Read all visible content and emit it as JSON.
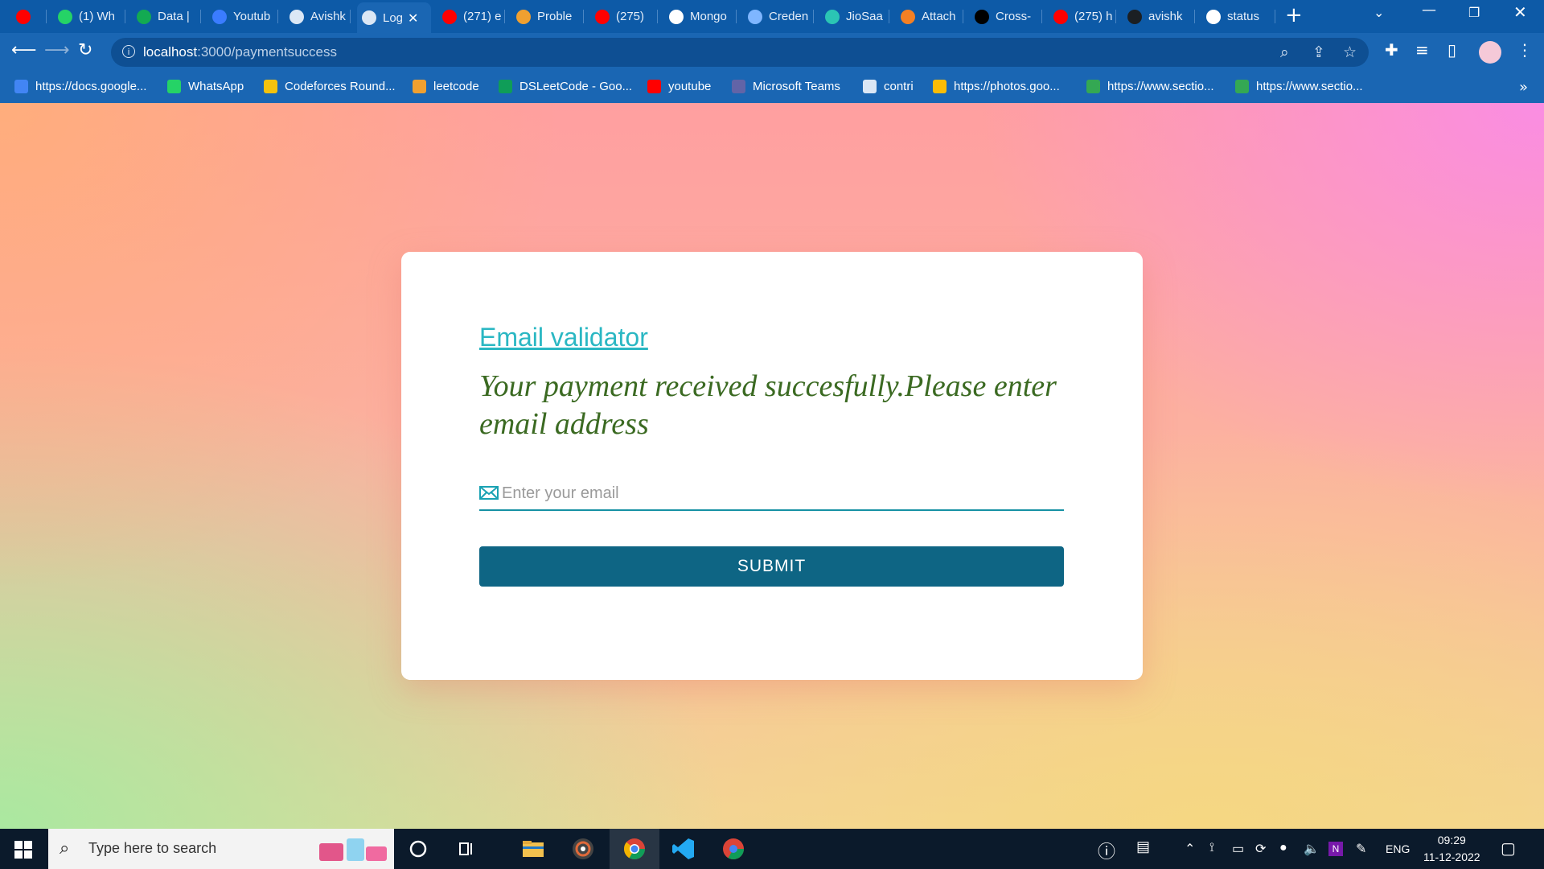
{
  "tabs": [
    {
      "title": "",
      "icon": "youtube-icon",
      "color": "#ff0000"
    },
    {
      "title": "(1) Wh",
      "icon": "whatsapp-icon",
      "color": "#25d366"
    },
    {
      "title": "Data | ",
      "icon": "mongodb-leaf-icon",
      "color": "#13aa52"
    },
    {
      "title": "Youtub",
      "icon": "search-app-icon",
      "color": "#3b7cff"
    },
    {
      "title": "Avishk",
      "icon": "globe-icon",
      "color": "#dbe7f5"
    },
    {
      "title": "Log",
      "icon": "globe-icon",
      "color": "#dbe7f5",
      "active": true
    },
    {
      "title": "(271) e",
      "icon": "youtube-icon",
      "color": "#ff0000"
    },
    {
      "title": "Proble",
      "icon": "leetcode-icon",
      "color": "#f0a030"
    },
    {
      "title": "(275)",
      "icon": "youtube-icon",
      "color": "#ff0000"
    },
    {
      "title": "Mongo",
      "icon": "book-icon",
      "color": "#ffffff"
    },
    {
      "title": "Creden",
      "icon": "api-icon",
      "color": "#7fb6ff"
    },
    {
      "title": "JioSaa",
      "icon": "jiosaavn-icon",
      "color": "#2bc5b4"
    },
    {
      "title": "Attach",
      "icon": "stackoverflow-icon",
      "color": "#f48024"
    },
    {
      "title": "Cross-",
      "icon": "medium-icon",
      "color": "#000000"
    },
    {
      "title": "(275) h",
      "icon": "youtube-icon",
      "color": "#ff0000"
    },
    {
      "title": "avishk",
      "icon": "github-icon",
      "color": "#1b1f23"
    },
    {
      "title": "status",
      "icon": "google-icon",
      "color": "#ffffff"
    }
  ],
  "omnibox": {
    "host": "localhost",
    "path": ":3000/paymentsuccess"
  },
  "bookmarks": [
    {
      "label": "https://docs.google...",
      "icon": "docs-icon",
      "color": "#4285f4"
    },
    {
      "label": "WhatsApp",
      "icon": "whatsapp-icon",
      "color": "#25d366"
    },
    {
      "label": "Codeforces Round...",
      "icon": "codeforces-icon",
      "color": "#f4c20d"
    },
    {
      "label": "leetcode",
      "icon": "leetcode-icon",
      "color": "#f0a030"
    },
    {
      "label": "DSLeetCode - Goo...",
      "icon": "sheets-icon",
      "color": "#0f9d58"
    },
    {
      "label": "youtube",
      "icon": "youtube-icon",
      "color": "#ff0000"
    },
    {
      "label": "Microsoft Teams",
      "icon": "teams-icon",
      "color": "#6264a7"
    },
    {
      "label": "contri",
      "icon": "globe-icon",
      "color": "#dbe7f5"
    },
    {
      "label": "https://photos.goo...",
      "icon": "photos-icon",
      "color": "#fbbc05"
    },
    {
      "label": "https://www.sectio...",
      "icon": "sheets-icon",
      "color": "#34a853"
    },
    {
      "label": "https://www.sectio...",
      "icon": "sheets-icon",
      "color": "#34a853"
    }
  ],
  "page": {
    "title": "Email validator",
    "message": "Your payment received succesfully.Please enter email address",
    "email_placeholder": "Enter your email",
    "submit_label": "SUBMIT"
  },
  "taskbar": {
    "search_placeholder": "Type here to search",
    "language": "ENG",
    "time": "09:29",
    "date": "11-12-2022"
  },
  "colors": {
    "title": "#2ab7c3",
    "message": "#3b6a22",
    "submit": "#0e6584",
    "browser_chrome": "#1a66b3"
  }
}
